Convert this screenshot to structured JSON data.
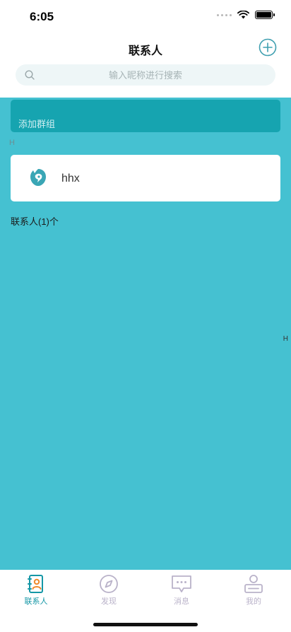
{
  "status_bar": {
    "time": "6:05"
  },
  "header": {
    "title": "联系人"
  },
  "search": {
    "placeholder": "输入昵称进行搜索"
  },
  "group": {
    "label": "添加群组"
  },
  "section": {
    "letter": "H"
  },
  "contacts": [
    {
      "name": "hhx"
    }
  ],
  "contact_count": "联系人(1)个",
  "index_bar": {
    "letter": "H"
  },
  "tabs": [
    {
      "label": "联系人",
      "active": true
    },
    {
      "label": "发现",
      "active": false
    },
    {
      "label": "消息",
      "active": false
    },
    {
      "label": "我的",
      "active": false
    }
  ],
  "colors": {
    "teal_bg": "#45c1d1",
    "group_bar": "#16a4b0",
    "active_tab": "#1597a6",
    "inactive_tab": "#b9b2c9"
  },
  "icons": [
    "add-icon",
    "search-icon",
    "contacts-icon",
    "compass-icon",
    "message-icon",
    "profile-icon"
  ]
}
